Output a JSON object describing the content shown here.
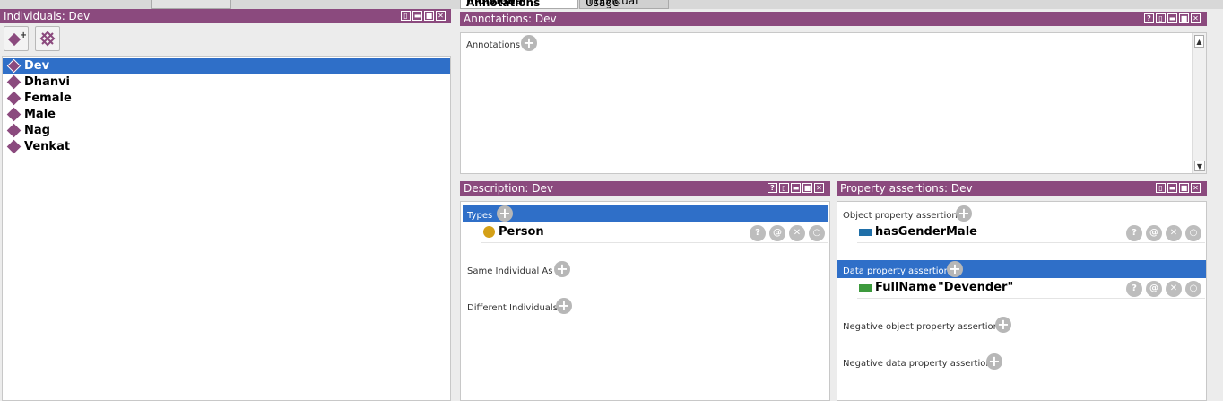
{
  "tabs": {
    "top_left_partial": "",
    "active": "Individual Annotations",
    "inactive": "Individual Usage"
  },
  "individuals": {
    "title": "Individuals: Dev",
    "items": [
      "Dev",
      "Dhanvi",
      "Female",
      "Male",
      "Nag",
      "Venkat"
    ],
    "selected": "Dev"
  },
  "annotations": {
    "title": "Annotations: Dev",
    "label": "Annotations"
  },
  "description": {
    "title": "Description: Dev",
    "types_label": "Types",
    "type_value": "Person",
    "same_label": "Same Individual As",
    "different_label": "Different Individuals"
  },
  "property_assertions": {
    "title": "Property assertions: Dev",
    "object_label": "Object property assertions",
    "object_prop": "hasGender",
    "object_value": "Male",
    "data_label": "Data property assertions",
    "data_prop": "FullName",
    "data_value": "\"Devender\"",
    "neg_object_label": "Negative object property assertions",
    "neg_data_label": "Negative data property assertions"
  },
  "colors": {
    "title_bar": "#8b4a7e",
    "selection": "#2f6fc8",
    "class_dot": "#d4a017",
    "object_prop": "#1f6fa8",
    "data_prop": "#3d9a3d"
  }
}
